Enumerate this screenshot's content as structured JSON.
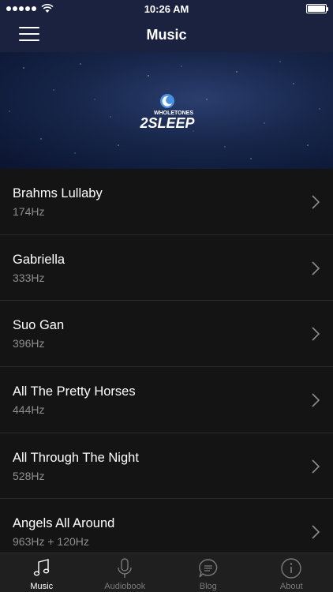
{
  "status": {
    "time": "10:26 AM"
  },
  "nav": {
    "title": "Music"
  },
  "banner": {
    "logo_top": "WHOLETONES",
    "logo_main": "2SLEEP"
  },
  "tracks": [
    {
      "title": "Brahms Lullaby",
      "freq": "174Hz"
    },
    {
      "title": "Gabriella",
      "freq": "333Hz"
    },
    {
      "title": "Suo Gan",
      "freq": "396Hz"
    },
    {
      "title": "All The Pretty Horses",
      "freq": "444Hz"
    },
    {
      "title": "All Through The Night",
      "freq": "528Hz"
    },
    {
      "title": "Angels All Around",
      "freq": "963Hz + 120Hz"
    }
  ],
  "tabs": [
    {
      "label": "Music",
      "icon": "music-note-icon",
      "active": true
    },
    {
      "label": "Audiobook",
      "icon": "microphone-icon",
      "active": false
    },
    {
      "label": "Blog",
      "icon": "chat-bubble-icon",
      "active": false
    },
    {
      "label": "About",
      "icon": "info-icon",
      "active": false
    }
  ],
  "colors": {
    "nav_bg": "#1b2240",
    "list_bg": "#141414",
    "accent_blue": "#4a90e2"
  }
}
